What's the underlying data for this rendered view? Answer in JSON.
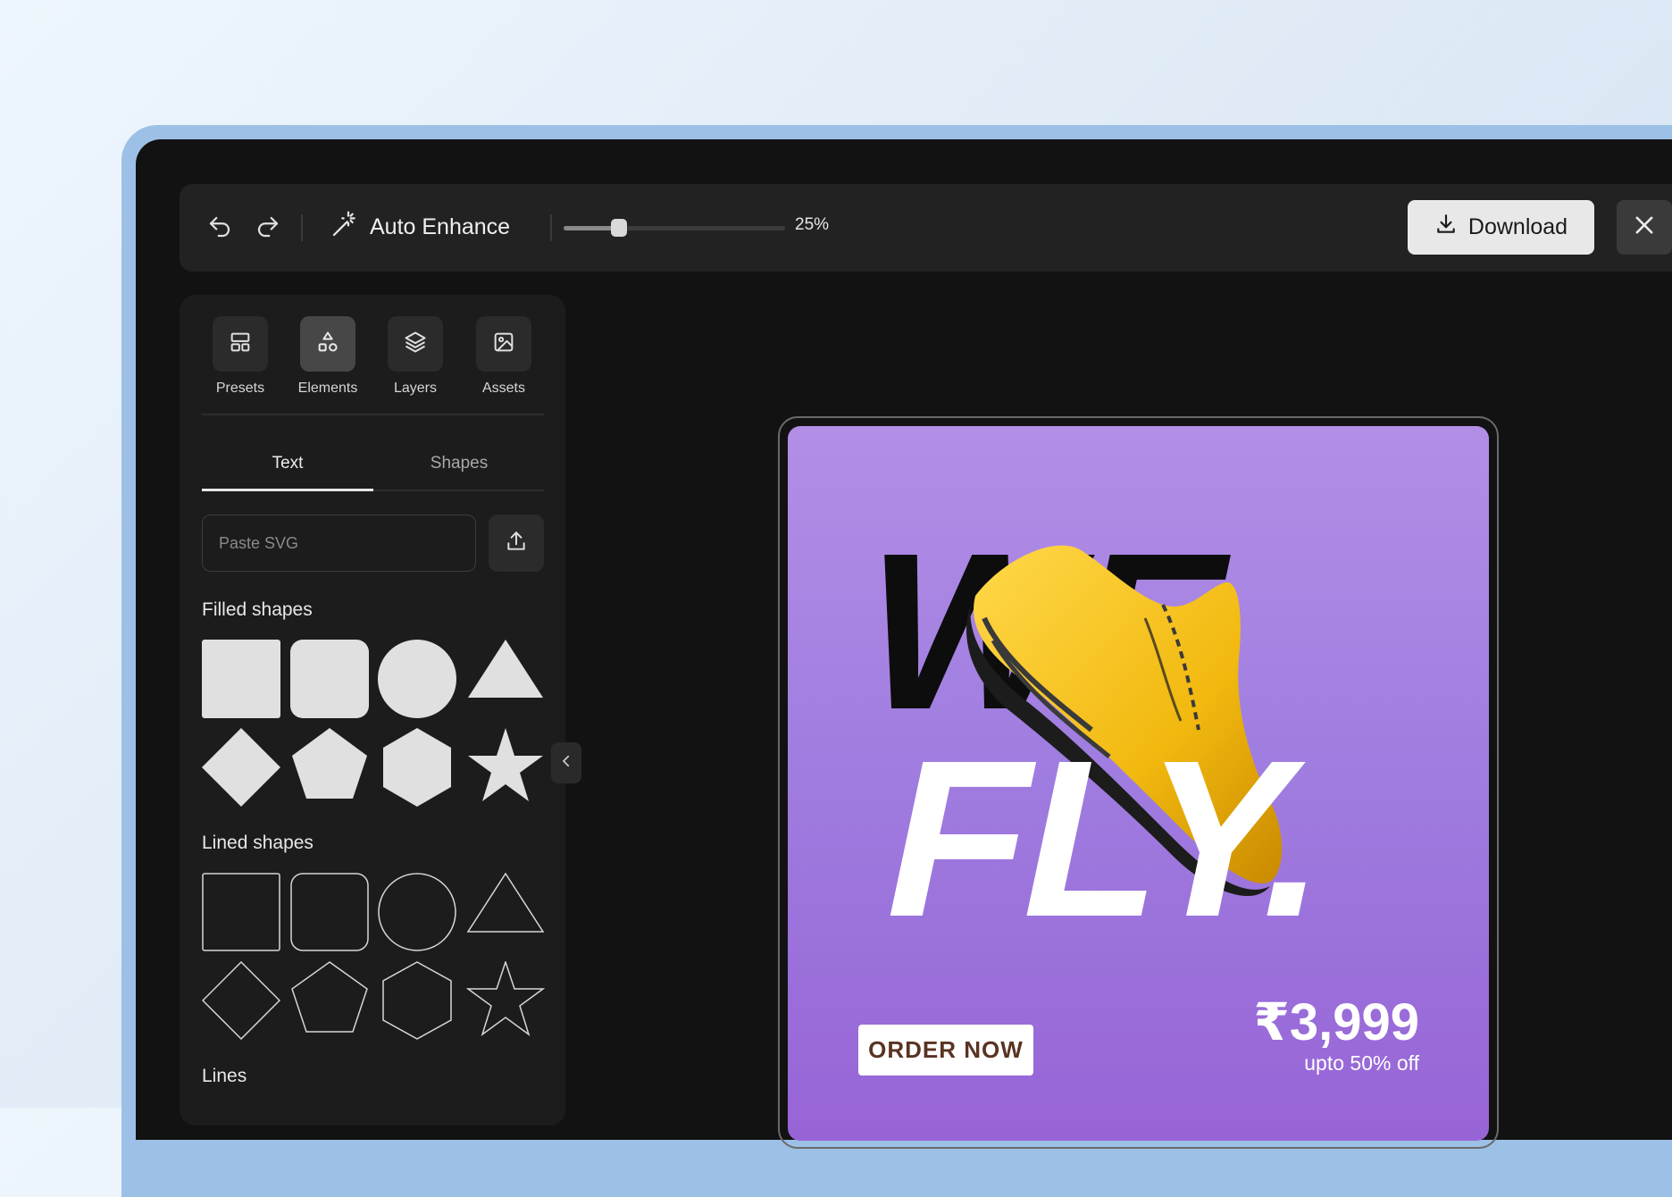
{
  "toolbar": {
    "undo_icon": "undo-icon",
    "redo_icon": "redo-icon",
    "auto_enhance_label": "Auto Enhance",
    "zoom": {
      "value_percent": 25,
      "label": "25%"
    },
    "download_label": "Download",
    "close_icon": "close-icon"
  },
  "sidebar": {
    "nav": [
      {
        "label": "Presets",
        "icon": "layout-icon",
        "active": false
      },
      {
        "label": "Elements",
        "icon": "shapes-icon",
        "active": true
      },
      {
        "label": "Layers",
        "icon": "layers-icon",
        "active": false
      },
      {
        "label": "Assets",
        "icon": "image-icon",
        "active": false
      }
    ],
    "tabs": [
      {
        "label": "Text",
        "active": true
      },
      {
        "label": "Shapes",
        "active": false
      }
    ],
    "svg_input": {
      "placeholder": "Paste SVG",
      "value": ""
    },
    "sections": {
      "filled": "Filled shapes",
      "lined": "Lined shapes",
      "lines": "Lines"
    },
    "shapes": [
      "square",
      "rounded-square",
      "circle",
      "triangle",
      "diamond",
      "pentagon",
      "hexagon",
      "star"
    ]
  },
  "poster": {
    "headline_top": "WE",
    "headline_bottom": "FLY.",
    "cta_label": "ORDER NOW",
    "price": "₹3,999",
    "discount": "upto 50% off",
    "colors": {
      "bg_top": "#b38ee6",
      "bg_bottom": "#9764d6",
      "shoe": "#f5c518"
    }
  }
}
